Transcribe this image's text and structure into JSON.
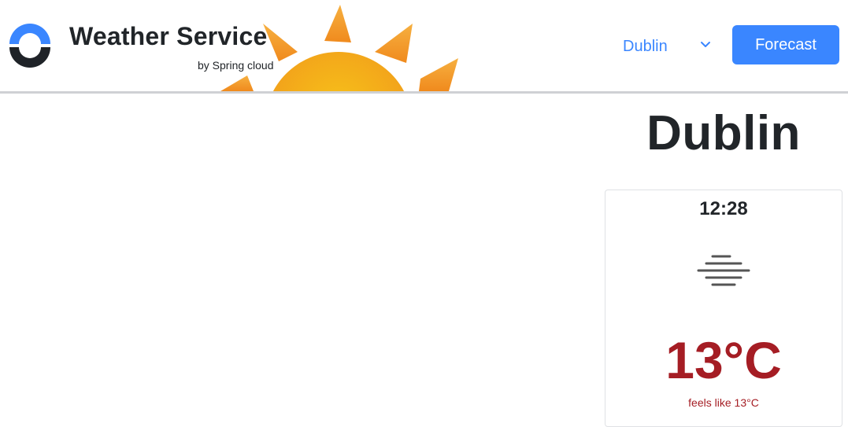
{
  "header": {
    "title": "Weather Service",
    "subtitle": "by Spring cloud",
    "city_select": {
      "selected": "Dublin"
    },
    "forecast_label": "Forecast"
  },
  "main": {
    "city_name": "Dublin",
    "card": {
      "time": "12:28",
      "condition_icon": "fog-icon",
      "temperature": "13°C",
      "feels_like": "feels like 13°C"
    }
  },
  "colors": {
    "accent": "#3a86ff",
    "temperature": "#a51d24",
    "sun": "#f5a623"
  }
}
